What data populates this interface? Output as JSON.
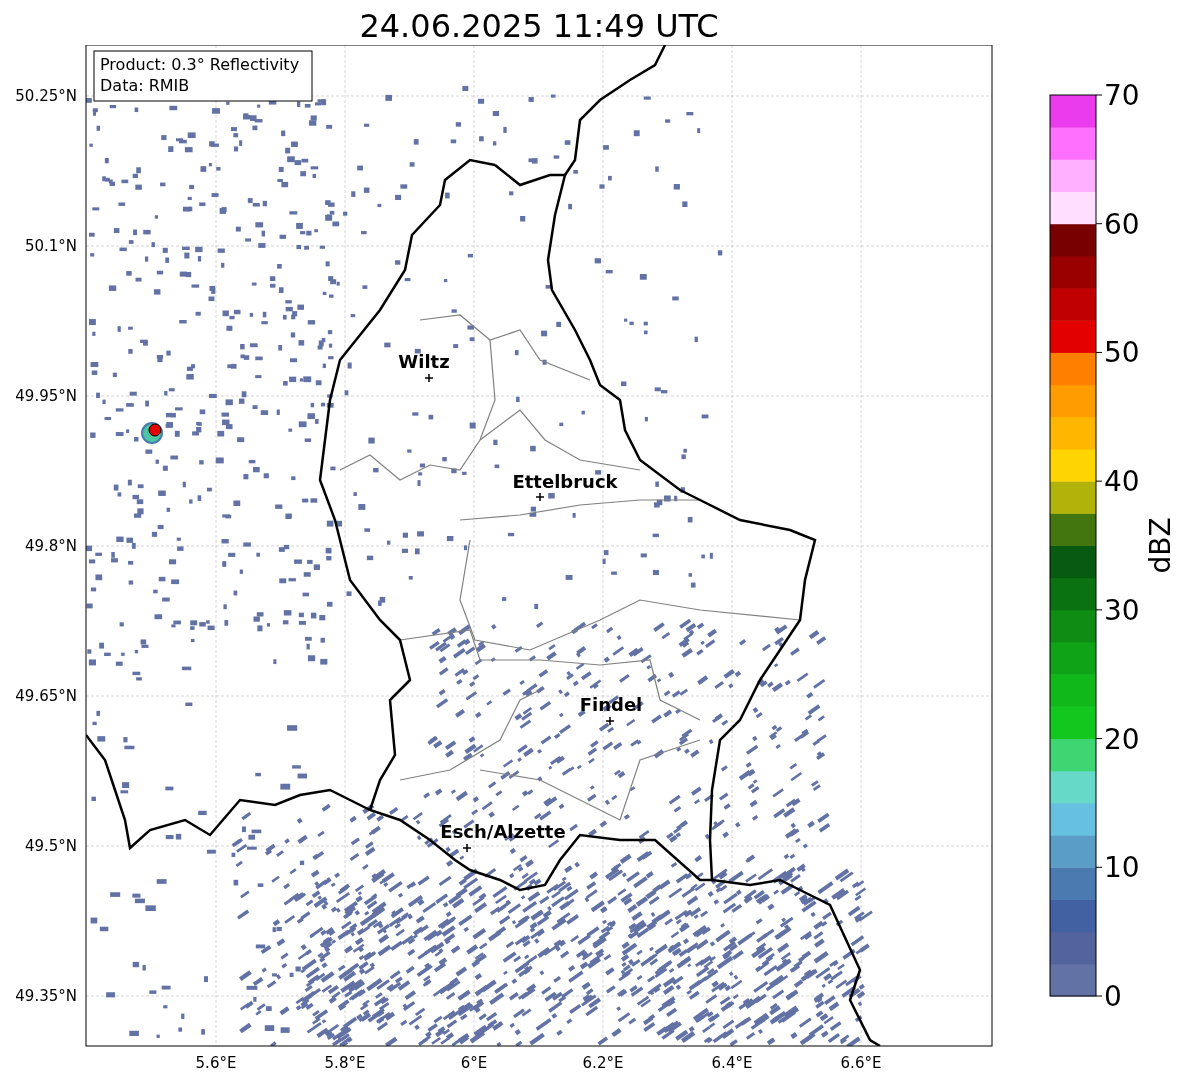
{
  "title": "24.06.2025 11:49 UTC",
  "info_box": {
    "lines": [
      "Product: 0.3° Reflectivity",
      "Data: RMIB"
    ]
  },
  "y_ticks": [
    "50.25°N",
    "50.1°N",
    "49.95°N",
    "49.8°N",
    "49.65°N",
    "49.5°N",
    "49.35°N"
  ],
  "x_ticks": [
    "5.6°E",
    "5.8°E",
    "6°E",
    "6.2°E",
    "6.4°E",
    "6.6°E"
  ],
  "cities": [
    "Wiltz",
    "Ettelbruck",
    "Findel",
    "Esch/Alzette"
  ],
  "colorbar": {
    "label": "dBZ",
    "ticks": [
      "70",
      "60",
      "50",
      "40",
      "30",
      "20",
      "10",
      "0"
    ]
  }
}
